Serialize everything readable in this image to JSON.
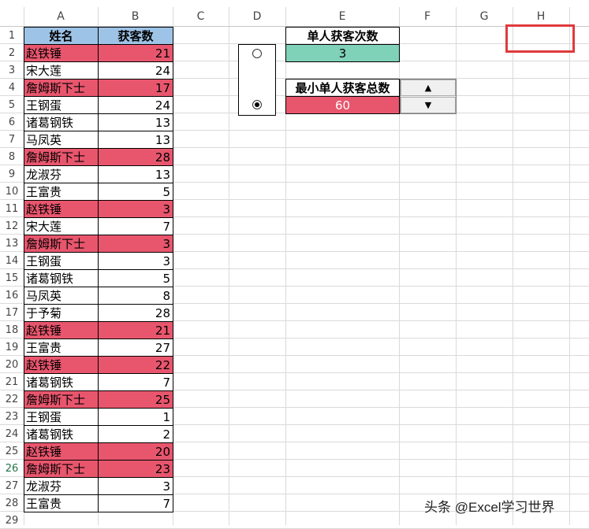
{
  "colors": {
    "header_fill": "#9dc3e6",
    "highlight_fill": "#e8566d",
    "count_fill": "#7fd1b7",
    "selection_border": "#e03a3e"
  },
  "columns": [
    "A",
    "B",
    "C",
    "D",
    "E",
    "F",
    "G",
    "H"
  ],
  "row_numbers": [
    "1",
    "2",
    "3",
    "4",
    "5",
    "6",
    "7",
    "8",
    "9",
    "10",
    "11",
    "12",
    "13",
    "14",
    "15",
    "16",
    "17",
    "18",
    "19",
    "20",
    "21",
    "22",
    "23",
    "24",
    "25",
    "26",
    "27",
    "28",
    "29"
  ],
  "table": {
    "headers": {
      "name": "姓名",
      "count": "获客数"
    },
    "rows": [
      {
        "name": "赵铁锤",
        "count": "21",
        "highlight": true
      },
      {
        "name": "宋大莲",
        "count": "24",
        "highlight": false
      },
      {
        "name": "詹姆斯下士",
        "count": "17",
        "highlight": true
      },
      {
        "name": "王钢蛋",
        "count": "24",
        "highlight": false
      },
      {
        "name": "诸葛钢铁",
        "count": "13",
        "highlight": false
      },
      {
        "name": "马凤英",
        "count": "13",
        "highlight": false
      },
      {
        "name": "詹姆斯下士",
        "count": "28",
        "highlight": true
      },
      {
        "name": "龙淑芬",
        "count": "13",
        "highlight": false
      },
      {
        "name": "王富贵",
        "count": "5",
        "highlight": false
      },
      {
        "name": "赵铁锤",
        "count": "3",
        "highlight": true
      },
      {
        "name": "宋大莲",
        "count": "7",
        "highlight": false
      },
      {
        "name": "詹姆斯下士",
        "count": "3",
        "highlight": true
      },
      {
        "name": "王钢蛋",
        "count": "3",
        "highlight": false
      },
      {
        "name": "诸葛钢铁",
        "count": "5",
        "highlight": false
      },
      {
        "name": "马凤英",
        "count": "8",
        "highlight": false
      },
      {
        "name": "于予菊",
        "count": "28",
        "highlight": false
      },
      {
        "name": "赵铁锤",
        "count": "21",
        "highlight": true
      },
      {
        "name": "王富贵",
        "count": "27",
        "highlight": false
      },
      {
        "name": "赵铁锤",
        "count": "22",
        "highlight": true
      },
      {
        "name": "诸葛钢铁",
        "count": "7",
        "highlight": false
      },
      {
        "name": "詹姆斯下士",
        "count": "25",
        "highlight": true
      },
      {
        "name": "王钢蛋",
        "count": "1",
        "highlight": false
      },
      {
        "name": "诸葛钢铁",
        "count": "2",
        "highlight": false
      },
      {
        "name": "赵铁锤",
        "count": "20",
        "highlight": true
      },
      {
        "name": "詹姆斯下士",
        "count": "23",
        "highlight": true
      },
      {
        "name": "龙淑芬",
        "count": "3",
        "highlight": false
      },
      {
        "name": "王富贵",
        "count": "7",
        "highlight": false
      }
    ]
  },
  "criteria": {
    "times_label": "单人获客次数",
    "times_value": "3",
    "min_total_label": "最小单人获客总数",
    "min_total_value": "60"
  },
  "spinner": {
    "up_label": "▲",
    "down_label": "▼"
  },
  "option_group": {
    "option1_selected": false,
    "option2_selected": true
  },
  "active_row": "26",
  "watermark": "头条 @Excel学习世界"
}
